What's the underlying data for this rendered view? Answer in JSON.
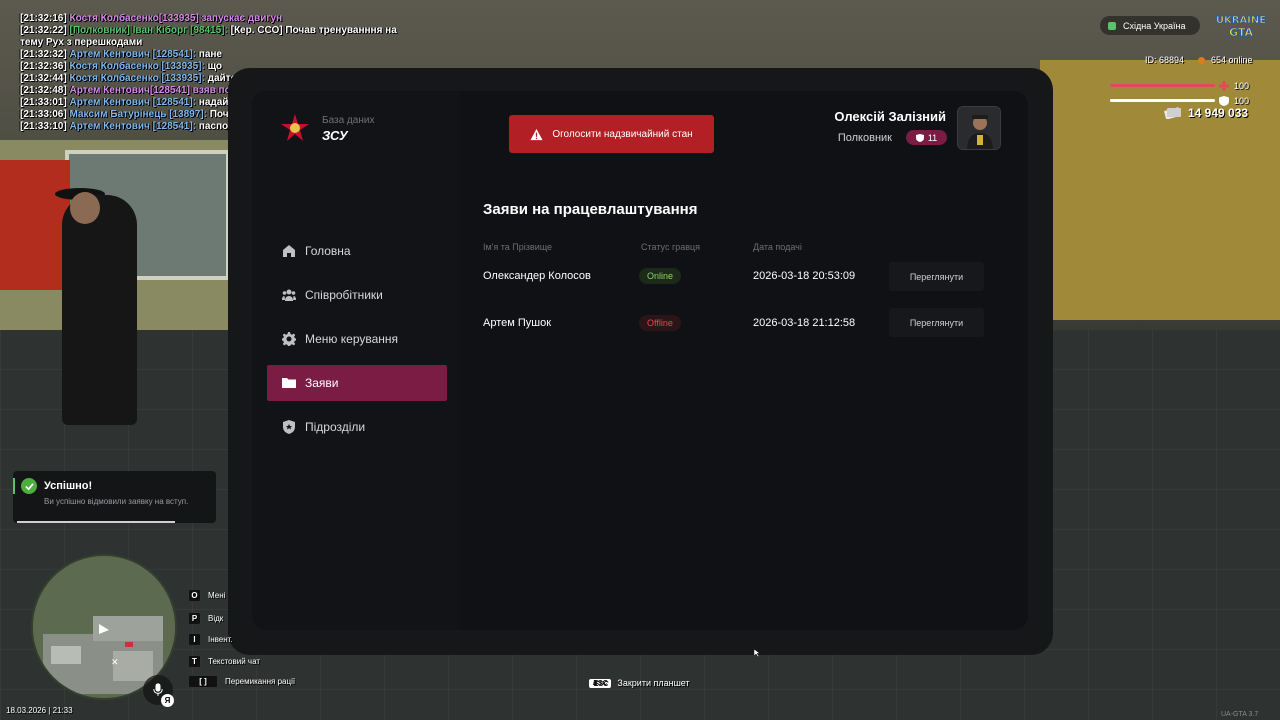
{
  "chat": [
    {
      "ts": "[21:32:16]",
      "parts": [
        {
          "t": "Костя Колбасенко[133935] запускає двигун",
          "c": "purple"
        }
      ]
    },
    {
      "ts": "[21:32:22]",
      "parts": [
        {
          "t": "[Полковник] Іван Кіборг [98415]: ",
          "c": "green"
        },
        {
          "t": "[Кер. ССО] Почав тренуванння на",
          "c": "white"
        }
      ]
    },
    {
      "ts": "",
      "parts": [
        {
          "t": " тему Рух з перешкодами",
          "c": "white"
        }
      ]
    },
    {
      "ts": "[21:32:32]",
      "parts": [
        {
          "t": "Артем Кентович [128541]: ",
          "c": "blue"
        },
        {
          "t": "пане",
          "c": "white"
        }
      ]
    },
    {
      "ts": "[21:32:36]",
      "parts": [
        {
          "t": "Костя Колбасенко [133935]: ",
          "c": "blue"
        },
        {
          "t": "що",
          "c": "white"
        }
      ]
    },
    {
      "ts": "[21:32:44]",
      "parts": [
        {
          "t": "Костя Колбасенко [133935]: ",
          "c": "blue"
        },
        {
          "t": "дайте припаркуюся",
          "c": "white"
        }
      ]
    },
    {
      "ts": "[21:32:48]",
      "parts": [
        {
          "t": "Артем Кентович[128541] взяв посвічення",
          "c": "purple"
        }
      ]
    },
    {
      "ts": "[21:33:01]",
      "parts": [
        {
          "t": "Артем Кентович [128541]: ",
          "c": "blue"
        },
        {
          "t": "надайте ваш паспор",
          "c": "white"
        }
      ]
    },
    {
      "ts": "[21:33:06]",
      "parts": [
        {
          "t": "Максим Батурінець [13897]: ",
          "c": "blue"
        },
        {
          "t": "Почав допомогу на наборі ЗСУ",
          "c": "white"
        }
      ]
    },
    {
      "ts": "[21:33:10]",
      "parts": [
        {
          "t": "Артем Кентович [128541]: ",
          "c": "blue"
        },
        {
          "t": "паспорт",
          "c": "white"
        }
      ]
    }
  ],
  "tablet": {
    "logo_sub": "База даних",
    "logo_title": "ЗСУ",
    "alert_button": "Оголосити надзвичайний стан",
    "user_name": "Олексій Залізний",
    "user_rank": "Полковник",
    "rank_level": "11",
    "nav": [
      {
        "label": "Головна",
        "icon": "home-icon"
      },
      {
        "label": "Співробітники",
        "icon": "users-icon"
      },
      {
        "label": "Меню керування",
        "icon": "gear-icon"
      },
      {
        "label": "Заяви",
        "icon": "folder-icon",
        "active": true
      },
      {
        "label": "Підрозділи",
        "icon": "shield-icon"
      }
    ],
    "section_title": "Заяви на працевлаштування",
    "columns": [
      "Ім'я та Прізвище",
      "Статус гравця",
      "Дата подачі"
    ],
    "rows": [
      {
        "name": "Олександер Колосов",
        "status": "Online",
        "date": "2026-03-18 20:53:09",
        "action": "Переглянути"
      },
      {
        "name": "Артем Пушок",
        "status": "Offline",
        "date": "2026-03-18 21:12:58",
        "action": "Переглянути"
      }
    ]
  },
  "hud": {
    "server": "Східна Україна",
    "game_logo_line1": "UKRAINE",
    "game_logo_line2": "GTA",
    "id": "ID: 68894",
    "online": "654 online",
    "health": "100",
    "armor": "100",
    "health_level": 1.0,
    "armor_level": 1.0,
    "money": "14 949 033",
    "date": "18.03.2026 | 21:33",
    "version": "UA-GTA 3.7",
    "esc_key": "ESC",
    "esc_label": "Закрити планшет",
    "mic_letter": "Я"
  },
  "toast": {
    "title": "Успішно!",
    "text": "Ви успішно відмовили заявку на вступ."
  },
  "hints": [
    {
      "key": "O",
      "label": "Мені"
    },
    {
      "key": "P",
      "label": "Відк"
    },
    {
      "key": "I",
      "label": "Інвент."
    },
    {
      "key": "T",
      "label": "Текстовий чат"
    },
    {
      "key": "[  ]",
      "label": "Перемикання рації"
    }
  ],
  "colors": {
    "accent": "#7a1c43",
    "alert": "#b21f25",
    "online": "#8fd06a",
    "offline": "#e04a4f"
  }
}
